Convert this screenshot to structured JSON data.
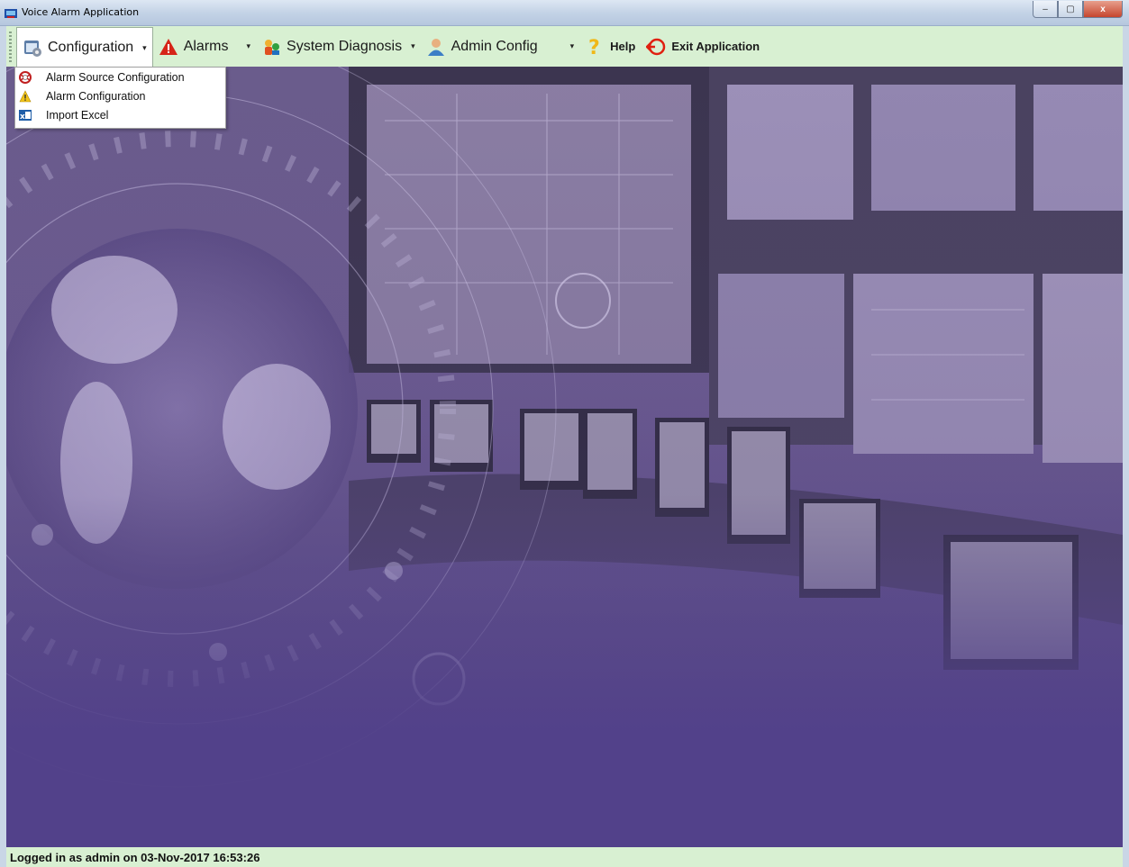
{
  "window": {
    "title": "Voice Alarm Application",
    "buttons": {
      "minimize": "–",
      "maximize": "▢",
      "close": "x"
    }
  },
  "menubar": {
    "items": [
      {
        "label": "Configuration",
        "icon": "configuration-icon"
      },
      {
        "label": "Alarms",
        "icon": "alarm-warning-icon"
      },
      {
        "label": "System Diagnosis",
        "icon": "diagnosis-icon"
      },
      {
        "label": "Admin Config",
        "icon": "admin-user-icon"
      },
      {
        "label": "Help",
        "icon": "help-icon"
      },
      {
        "label": "Exit Application",
        "icon": "exit-icon"
      }
    ]
  },
  "dropdown": {
    "items": [
      {
        "label": "Alarm Source Configuration",
        "icon": "lifebuoy-icon"
      },
      {
        "label": "Alarm Configuration",
        "icon": "warning-icon"
      },
      {
        "label": "Import Excel",
        "icon": "excel-icon"
      }
    ]
  },
  "status": {
    "text": "Logged in as admin on 03-Nov-2017 16:53:26"
  },
  "colors": {
    "menubar_bg": "#d8f0d2",
    "main_bg": "#5d4d89"
  }
}
